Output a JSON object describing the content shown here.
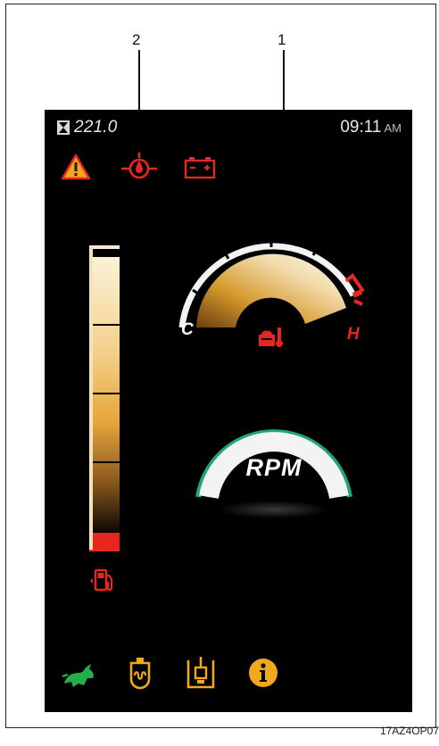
{
  "callouts": {
    "label_1": "1",
    "label_2": "2"
  },
  "status_bar": {
    "hour_meter": "221.0",
    "time": "09:11",
    "ampm": "AM"
  },
  "warning_icons": {
    "items": [
      "warning-triangle-icon",
      "oil-pressure-icon",
      "battery-icon"
    ]
  },
  "fuel_gauge": {
    "level_fraction": 0.95,
    "low_segment_on": true,
    "icon": "fuel-pump-icon"
  },
  "temp_gauge": {
    "cold_label": "C",
    "hot_label": "H",
    "level_fraction": 0.88,
    "icon": "coolant-temperature-icon"
  },
  "rpm_gauge": {
    "label": "RPM"
  },
  "bottom_bar": {
    "items": [
      "rabbit-speed-mode-icon",
      "glow-plug-icon",
      "parking-brake-icon",
      "info-icon"
    ]
  },
  "figure_code": "17AZ4OP07",
  "colors": {
    "red": "#e5271f",
    "amber": "#f2a81d",
    "green": "#22b04b",
    "gauge_white": "#f3f3f3",
    "gauge_green": "#1fa771"
  }
}
